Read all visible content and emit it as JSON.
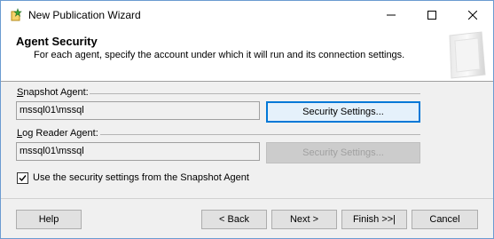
{
  "window": {
    "title": "New Publication Wizard"
  },
  "header": {
    "title": "Agent Security",
    "description": "For each agent, specify the account under which it will run and its connection settings."
  },
  "snapshot_agent": {
    "label_mnemonic": "S",
    "label_rest": "napshot Agent:",
    "account": "mssql01\\mssql",
    "security_button_label": "Security Settings..."
  },
  "log_reader_agent": {
    "label_mnemonic": "L",
    "label_rest": "og Reader Agent:",
    "account": "mssql01\\mssql",
    "security_button_label": "Security Settings..."
  },
  "use_snapshot_settings": {
    "checked": true,
    "label": "Use the security settings from the Snapshot Agent"
  },
  "footer": {
    "help_label": "Help",
    "back_label": "< Back",
    "next_label": "Next >",
    "finish_label": "Finish >>|",
    "cancel_label": "Cancel"
  },
  "colors": {
    "accent": "#0078d7",
    "window_border": "#6b9bd1"
  },
  "icons": {
    "app": "wizard-icon",
    "minimize": "minimize-icon",
    "maximize": "maximize-icon",
    "close": "close-icon",
    "header_art": "database-graphic-icon",
    "check": "checkmark-icon"
  }
}
